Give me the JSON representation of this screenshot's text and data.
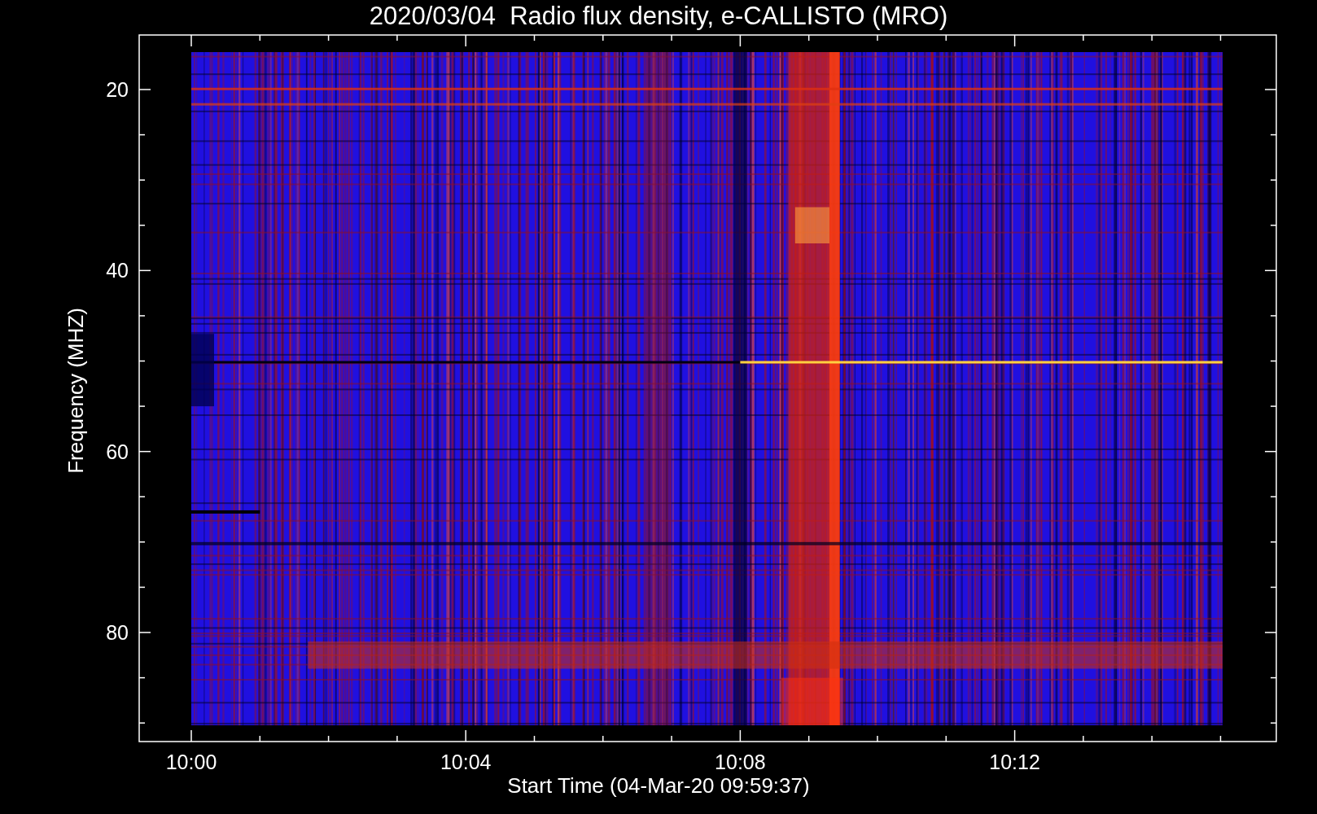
{
  "title": "2020/03/04  Radio flux density, e-CALLISTO (MRO)",
  "y_axis": {
    "label": "Frequency (MHZ)",
    "ticks": [
      "20",
      "40",
      "60",
      "80"
    ]
  },
  "x_axis": {
    "label": "Start Time (04-Mar-20 09:59:37)",
    "ticks": [
      "10:00",
      "10:04",
      "10:08",
      "10:12"
    ]
  }
}
